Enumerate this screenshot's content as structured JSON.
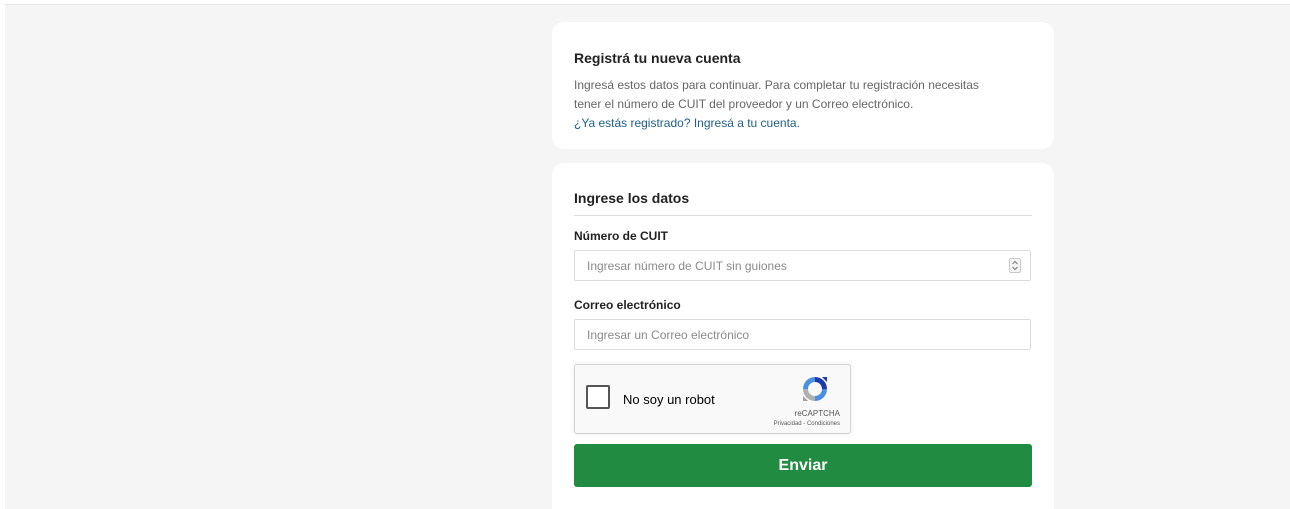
{
  "intro": {
    "title": "Registrá tu nueva cuenta",
    "description_line1": "Ingresá estos datos para continuar. Para completar tu registración necesitas",
    "description_line2": "tener el número de CUIT del proveedor y un Correo electrónico.",
    "login_link": "¿Ya estás registrado? Ingresá a tu cuenta."
  },
  "form": {
    "section_title": "Ingrese los datos",
    "cuit": {
      "label": "Número de CUIT",
      "value": "",
      "placeholder": "Ingresar número de CUIT sin guiones"
    },
    "email": {
      "label": "Correo electrónico",
      "value": "",
      "placeholder": "Ingresar un Correo electrónico"
    },
    "recaptcha": {
      "label": "No soy un robot",
      "brand": "reCAPTCHA",
      "terms": "Privacidad - Condiciones"
    },
    "submit_label": "Enviar"
  },
  "colors": {
    "background": "#f5f5f5",
    "card": "#ffffff",
    "link": "#1f5f86",
    "submit": "#218c41"
  },
  "icons": {
    "spinner": "spinner-arrows-icon",
    "recaptcha": "recaptcha-logo-icon"
  }
}
